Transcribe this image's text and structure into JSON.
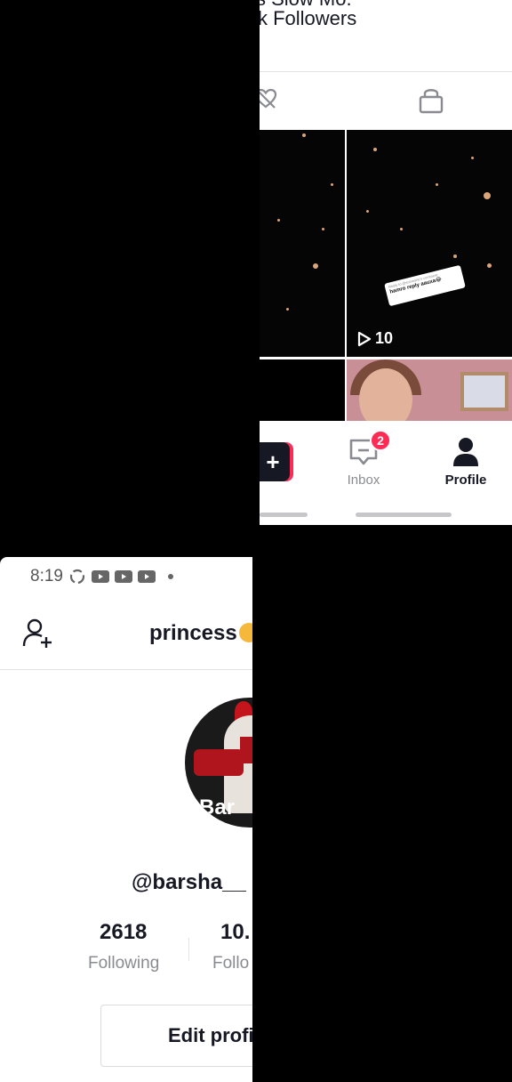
{
  "top_fragment": {
    "follow_line_1": "s Slow Mo.",
    "follow_line_2": "k Followers",
    "tabs": [
      {
        "icon": "liked-hidden-icon"
      },
      {
        "icon": "lock-icon"
      }
    ],
    "videos": [
      {
        "views": "10",
        "caption_title": "Reply to @someone's comment",
        "caption_body": "hamro reply aauxa😂"
      }
    ],
    "nav": {
      "create_label": "+",
      "inbox_label": "Inbox",
      "inbox_badge": "2",
      "profile_label": "Profile"
    }
  },
  "bottom_fragment": {
    "status": {
      "time": "8:19"
    },
    "title": "princess",
    "avatar_text": "Bar",
    "username": "@barsha__",
    "stats": {
      "following_count": "2618",
      "following_label": "Following",
      "followers_count": "10.",
      "followers_label": "Follo"
    },
    "edit_button_label": "Edit profi"
  },
  "colors": {
    "accent": "#fe2c55",
    "text_primary": "#161823",
    "text_secondary": "#8a8b91",
    "divider": "#e3e3e4"
  }
}
